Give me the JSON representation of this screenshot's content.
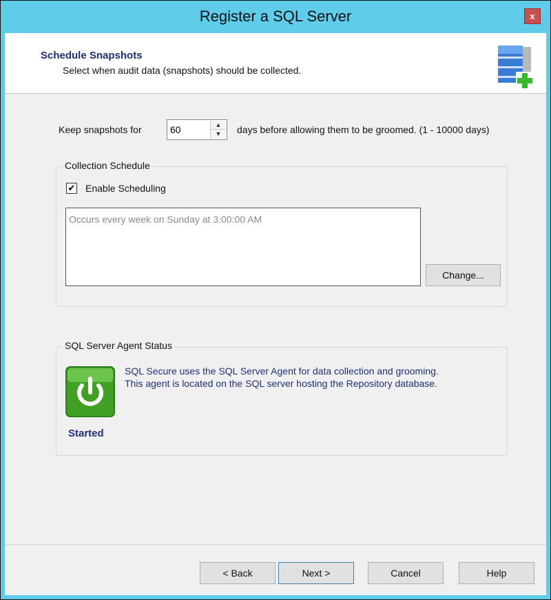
{
  "window": {
    "title": "Register a SQL Server",
    "close_label": "x"
  },
  "header": {
    "title": "Schedule Snapshots",
    "subtitle": "Select when audit data (snapshots) should be collected."
  },
  "retention": {
    "prefix": "Keep snapshots for",
    "value": "60",
    "suffix": "days before allowing them to be groomed. (1 - 10000 days)"
  },
  "collection": {
    "group_title": "Collection Schedule",
    "enable_label": "Enable Scheduling",
    "enabled": true,
    "schedule_text": "Occurs every week on Sunday at 3:00:00 AM",
    "change_label": "Change..."
  },
  "agent": {
    "group_title": "SQL Server Agent Status",
    "status": "Started",
    "line1": "SQL Secure uses the SQL Server Agent for data collection and grooming.",
    "line2": "This agent is located on the SQL server hosting the Repository database."
  },
  "footer": {
    "back_label": "< Back",
    "next_label": "Next >",
    "cancel_label": "Cancel",
    "help_label": "Help"
  },
  "colors": {
    "title_bar": "#5fcdea",
    "header_title": "#1e2f77",
    "close_button": "#c75050",
    "status_green": "#3fa023"
  }
}
